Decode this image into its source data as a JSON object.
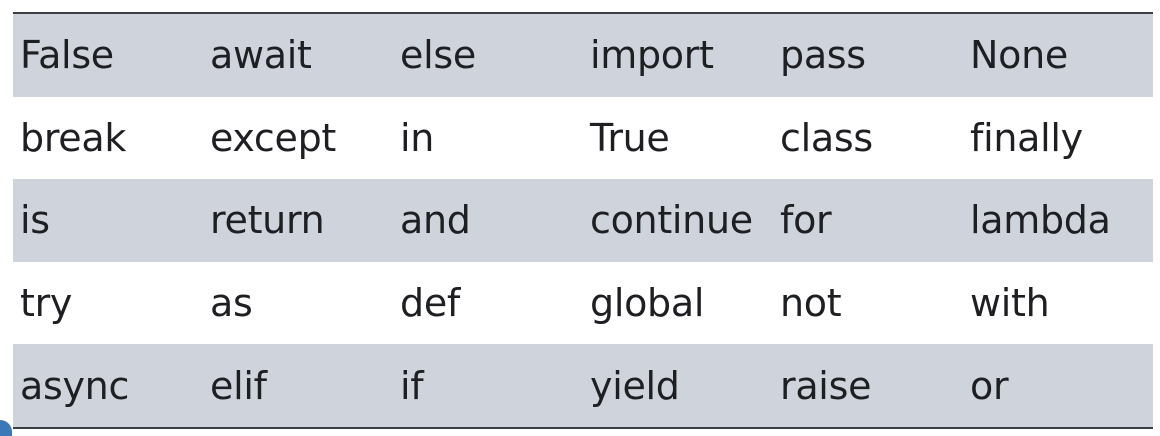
{
  "keywords_table": {
    "rows": [
      [
        "False",
        "await",
        "else",
        "import",
        "pass",
        "None"
      ],
      [
        "break",
        "except",
        "in",
        "True",
        "class",
        "finally"
      ],
      [
        "is",
        "return",
        "and",
        "continue",
        "for",
        "lambda"
      ],
      [
        "try",
        "as",
        "def",
        "global",
        "not",
        "with"
      ],
      [
        "async",
        "elif",
        "if",
        "yield",
        "raise",
        "or"
      ]
    ]
  },
  "colors": {
    "shaded_row": "#cfd4dc",
    "plain_row": "#ffffff",
    "rule": "#3c3f45",
    "text": "#1e1f22"
  }
}
